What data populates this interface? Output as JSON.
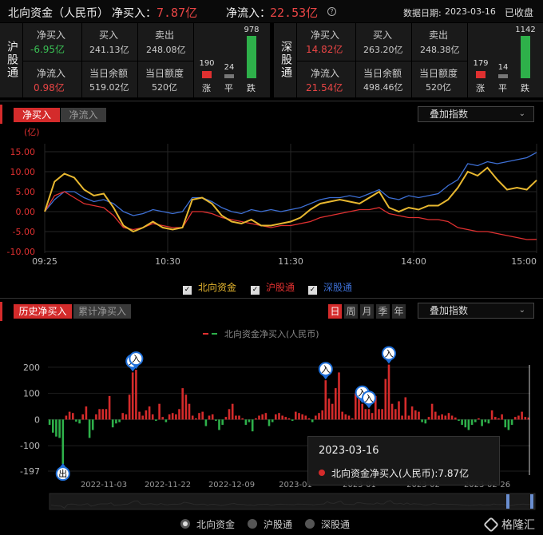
{
  "header": {
    "title": "北向资金（人民币）",
    "net_buy_label": "净买入：",
    "net_buy_value": "7.87亿",
    "net_flow_label": "净流入：",
    "net_flow_value": "22.53亿",
    "help_icon": "question-icon",
    "date_label": "数据日期:",
    "date_value": "2023-03-16",
    "status": "已收盘"
  },
  "panels": [
    {
      "name": "沪股通",
      "net_buy_label": "净买入",
      "net_buy_value": "-6.95亿",
      "buy_label": "买入",
      "buy_value": "241.13亿",
      "sell_label": "卖出",
      "sell_value": "248.08亿",
      "net_flow_label": "净流入",
      "net_flow_value": "0.98亿",
      "balance_label": "当日余额",
      "balance_value": "519.02亿",
      "quota_label": "当日额度",
      "quota_value": "520亿",
      "up_count": 190,
      "flat_count": 24,
      "down_count": 978,
      "up_label": "涨",
      "flat_label": "平",
      "down_label": "跌"
    },
    {
      "name": "深股通",
      "net_buy_label": "净买入",
      "net_buy_value": "14.82亿",
      "buy_label": "买入",
      "buy_value": "263.20亿",
      "sell_label": "卖出",
      "sell_value": "248.38亿",
      "net_flow_label": "净流入",
      "net_flow_value": "21.54亿",
      "balance_label": "当日余额",
      "balance_value": "498.46亿",
      "quota_label": "当日额度",
      "quota_value": "520亿",
      "up_count": 179,
      "flat_count": 14,
      "down_count": 1142,
      "up_label": "涨",
      "flat_label": "平",
      "down_label": "跌"
    }
  ],
  "intraday_tabs": [
    "净买入",
    "净流入"
  ],
  "history_tabs": [
    "历史净买入",
    "累计净买入"
  ],
  "overlay_index": "叠加指数",
  "period_buttons": [
    "日",
    "周",
    "月",
    "季",
    "年"
  ],
  "legend_intraday": [
    "北向资金",
    "沪股通",
    "深股通"
  ],
  "legend_bottom": [
    "北向资金",
    "沪股通",
    "深股通"
  ],
  "history_series_label": "北向资金净买入(人民币)",
  "tooltip": {
    "date": "2023-03-16",
    "text": "北向资金净买入(人民币):7.87亿"
  },
  "colors": {
    "north": "#e8b830",
    "sh": "#e03030",
    "sz": "#3d6fd4",
    "up": "#d42b2b",
    "down": "#2eb04a"
  },
  "chart_data": [
    {
      "type": "line",
      "ylabel": "(亿)",
      "ylim": [
        -10,
        15
      ],
      "yticks": [
        "15.00",
        "10.00",
        "5.00",
        "0.00",
        "-5.00",
        "-10.00"
      ],
      "xticks": [
        "09:25",
        "10:30",
        "11:30",
        "14:00",
        "15:00"
      ],
      "x_range": [
        0,
        1
      ],
      "series": [
        {
          "name": "北向资金",
          "x": [
            0.0,
            0.02,
            0.04,
            0.06,
            0.08,
            0.1,
            0.12,
            0.14,
            0.16,
            0.18,
            0.2,
            0.22,
            0.24,
            0.26,
            0.28,
            0.3,
            0.32,
            0.34,
            0.36,
            0.38,
            0.4,
            0.42,
            0.44,
            0.46,
            0.48,
            0.5,
            0.52,
            0.54,
            0.56,
            0.58,
            0.6,
            0.62,
            0.64,
            0.66,
            0.68,
            0.7,
            0.72,
            0.74,
            0.76,
            0.78,
            0.8,
            0.82,
            0.84,
            0.86,
            0.88,
            0.9,
            0.92,
            0.94,
            0.96,
            0.98,
            1.0
          ],
          "values": [
            0,
            7.5,
            9.5,
            8.5,
            5.5,
            4.0,
            4.5,
            1.0,
            -3.5,
            -5.0,
            -4.0,
            -2.5,
            -4.0,
            -4.5,
            -4.0,
            3.0,
            3.5,
            2.0,
            -1.0,
            -2.5,
            -3.0,
            -2.0,
            -3.5,
            -3.5,
            -3.0,
            -2.5,
            -1.5,
            0.5,
            2.0,
            2.5,
            3.0,
            2.5,
            2.0,
            3.5,
            5.0,
            1.0,
            0.0,
            1.0,
            0.5,
            1.5,
            1.5,
            3.0,
            6.0,
            10.0,
            9.0,
            11.0,
            8.0,
            5.5,
            6.0,
            5.5,
            7.87
          ]
        },
        {
          "name": "沪股通",
          "x": [
            0.0,
            0.02,
            0.04,
            0.06,
            0.08,
            0.1,
            0.12,
            0.14,
            0.16,
            0.18,
            0.2,
            0.22,
            0.24,
            0.26,
            0.28,
            0.3,
            0.32,
            0.34,
            0.36,
            0.38,
            0.4,
            0.42,
            0.44,
            0.46,
            0.48,
            0.5,
            0.52,
            0.54,
            0.56,
            0.58,
            0.6,
            0.62,
            0.64,
            0.66,
            0.68,
            0.7,
            0.72,
            0.74,
            0.76,
            0.78,
            0.8,
            0.82,
            0.84,
            0.86,
            0.88,
            0.9,
            0.92,
            0.94,
            0.96,
            0.98,
            1.0
          ],
          "values": [
            0,
            4.0,
            5.0,
            3.5,
            2.0,
            1.5,
            1.0,
            -1.0,
            -4.0,
            -4.5,
            -4.0,
            -3.0,
            -3.5,
            -4.0,
            -4.0,
            0.0,
            0.0,
            -0.5,
            -1.5,
            -2.0,
            -2.5,
            -3.0,
            -3.5,
            -4.0,
            -3.5,
            -3.5,
            -3.0,
            -2.5,
            -1.5,
            -1.0,
            -0.5,
            0.0,
            0.5,
            0.5,
            1.0,
            -0.5,
            -1.0,
            -1.5,
            -1.5,
            -2.0,
            -2.0,
            -2.5,
            -4.0,
            -4.5,
            -5.0,
            -5.0,
            -5.5,
            -6.0,
            -6.5,
            -7.0,
            -6.95
          ]
        },
        {
          "name": "深股通",
          "x": [
            0.0,
            0.02,
            0.04,
            0.06,
            0.08,
            0.1,
            0.12,
            0.14,
            0.16,
            0.18,
            0.2,
            0.22,
            0.24,
            0.26,
            0.28,
            0.3,
            0.32,
            0.34,
            0.36,
            0.38,
            0.4,
            0.42,
            0.44,
            0.46,
            0.48,
            0.5,
            0.52,
            0.54,
            0.56,
            0.58,
            0.6,
            0.62,
            0.64,
            0.66,
            0.68,
            0.7,
            0.72,
            0.74,
            0.76,
            0.78,
            0.8,
            0.82,
            0.84,
            0.86,
            0.88,
            0.9,
            0.92,
            0.94,
            0.96,
            0.98,
            1.0
          ],
          "values": [
            0,
            3.0,
            5.0,
            5.0,
            3.5,
            2.5,
            3.0,
            2.0,
            0.0,
            -1.0,
            -0.5,
            0.5,
            0.0,
            -0.5,
            0.0,
            3.5,
            3.5,
            2.5,
            1.0,
            0.0,
            -0.5,
            0.5,
            0.0,
            0.5,
            0.0,
            0.5,
            1.0,
            2.0,
            3.0,
            3.5,
            3.5,
            4.0,
            3.5,
            4.5,
            5.5,
            3.5,
            3.0,
            4.0,
            3.5,
            4.0,
            4.5,
            6.5,
            8.0,
            12.0,
            11.5,
            12.5,
            12.0,
            12.5,
            13.0,
            13.5,
            14.82
          ]
        }
      ]
    },
    {
      "type": "bar",
      "ylim": [
        -197,
        230
      ],
      "yticks": [
        "200",
        "100",
        "0",
        "-100",
        "-197"
      ],
      "xticks": [
        "2022-11-03",
        "2022-11-22",
        "2022-12-09",
        "2023-01",
        "2023-01",
        "2023-02",
        "2023-02-26"
      ],
      "series": [
        {
          "name": "北向资金净买入(人民币)",
          "values": [
            -20,
            -50,
            -65,
            -70,
            -170,
            15,
            30,
            25,
            -8,
            -15,
            20,
            50,
            -70,
            -40,
            20,
            40,
            40,
            40,
            90,
            -30,
            -15,
            -10,
            25,
            20,
            95,
            180,
            190,
            30,
            15,
            35,
            50,
            20,
            -5,
            60,
            10,
            -10,
            20,
            25,
            20,
            40,
            120,
            95,
            60,
            15,
            5,
            25,
            30,
            -25,
            15,
            20,
            -5,
            -40,
            -20,
            10,
            40,
            60,
            15,
            15,
            5,
            -20,
            -10,
            -45,
            5,
            15,
            20,
            25,
            -25,
            -10,
            20,
            25,
            15,
            10,
            5,
            -5,
            30,
            25,
            20,
            15,
            5,
            -10,
            15,
            25,
            35,
            150,
            80,
            60,
            120,
            180,
            30,
            20,
            15,
            5,
            100,
            95,
            60,
            40,
            40,
            25,
            90,
            40,
            40,
            155,
            210,
            60,
            40,
            70,
            15,
            85,
            15,
            50,
            35,
            30,
            -10,
            -15,
            10,
            60,
            30,
            15,
            20,
            15,
            25,
            15,
            8,
            -5,
            -20,
            -30,
            -40,
            -20,
            -10,
            5,
            -25,
            -10,
            -15,
            35,
            10,
            5,
            20,
            -30,
            -40,
            -20,
            10,
            15,
            30,
            10,
            7.87
          ]
        }
      ],
      "markers": [
        {
          "text": "入",
          "index": 25
        },
        {
          "text": "入",
          "index": 26
        },
        {
          "text": "入",
          "index": 83
        },
        {
          "text": "入",
          "index": 94
        },
        {
          "text": "入",
          "index": 96
        },
        {
          "text": "入",
          "index": 102
        },
        {
          "text": "出",
          "index": 4
        }
      ]
    }
  ]
}
